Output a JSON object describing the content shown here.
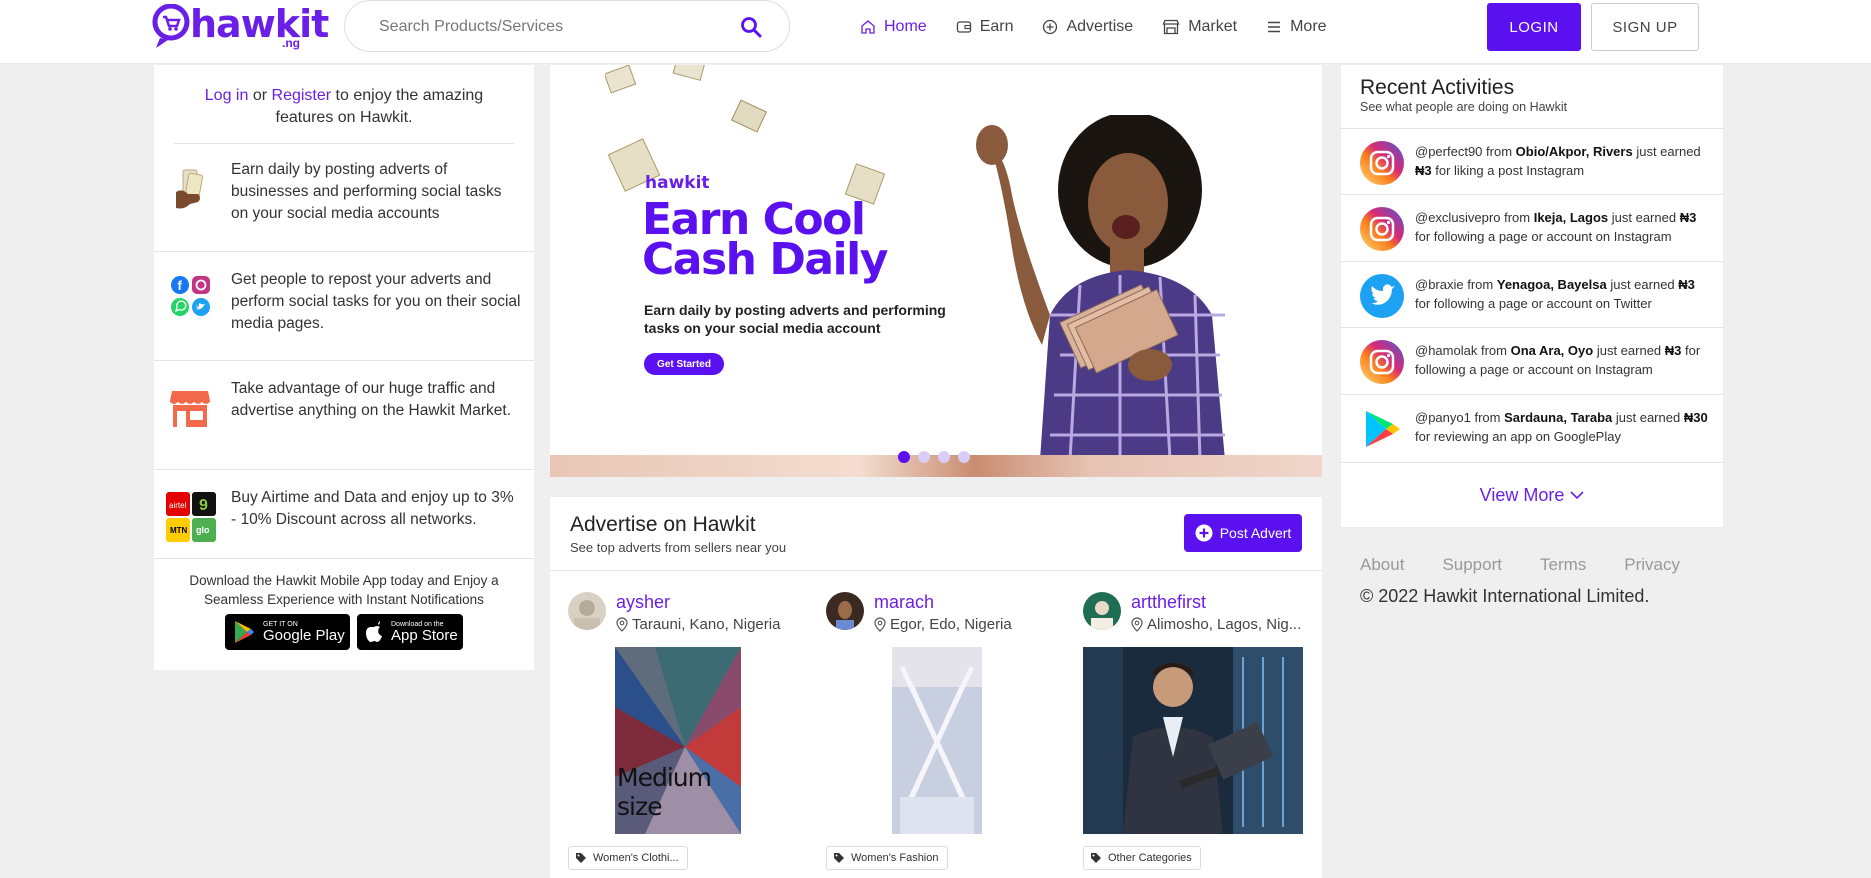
{
  "header": {
    "logo_text": "hawkit",
    "logo_suffix": ".ng",
    "search_placeholder": "Search Products/Services",
    "nav": [
      {
        "label": "Home",
        "icon": "home-icon",
        "active": true
      },
      {
        "label": "Earn",
        "icon": "wallet-icon"
      },
      {
        "label": "Advertise",
        "icon": "plus-circle-icon"
      },
      {
        "label": "Market",
        "icon": "store-icon"
      },
      {
        "label": "More",
        "icon": "menu-icon"
      }
    ],
    "login_label": "LOGIN",
    "signup_label": "SIGN UP"
  },
  "left": {
    "intro_login": "Log in",
    "intro_or": "or",
    "intro_register": "Register",
    "intro_rest": "to enjoy the amazing features on Hawkit.",
    "features": [
      {
        "icon": "money-hand-icon",
        "text": "Earn daily by posting adverts of businesses and performing social tasks on your social media accounts"
      },
      {
        "icon": "social-media-icon",
        "text": "Get people to repost your adverts and perform social tasks for you on their social media pages."
      },
      {
        "icon": "shop-icon",
        "text": "Take advantage of our huge traffic and advertise anything on the Hawkit Market."
      },
      {
        "icon": "network-logos-icon",
        "text": "Buy Airtime and Data and enjoy up to 3% - 10% Discount across all networks."
      }
    ],
    "download_text": "Download the Hawkit Mobile App today and Enjoy a Seamless Experience with Instant Notifications",
    "google_play_small": "GET IT ON",
    "google_play_big": "Google Play",
    "app_store_small": "Download on the",
    "app_store_big": "App Store"
  },
  "banner": {
    "logo": "hawkit",
    "title_line1": "Earn Cool",
    "title_line2": "Cash Daily",
    "subtitle": "Earn daily by posting adverts and performing tasks on your social media account",
    "button": "Get Started",
    "slide_count": 4,
    "active_slide": 1
  },
  "advertise": {
    "title": "Advertise on Hawkit",
    "subtitle": "See top adverts from sellers near you",
    "post_button": "Post Advert",
    "cards": [
      {
        "name": "aysher",
        "location": "Tarauni, Kano, Nigeria",
        "image_caption": "Medium size",
        "tag": "Women's Clothi..."
      },
      {
        "name": "marach",
        "location": "Egor, Edo, Nigeria",
        "tag": "Women's Fashion"
      },
      {
        "name": "artthefirst",
        "location": "Alimosho, Lagos, Nig...",
        "tag": "Other Categories"
      }
    ]
  },
  "activities": {
    "title": "Recent Activities",
    "subtitle": "See what people are doing on Hawkit",
    "items": [
      {
        "icon": "instagram-icon",
        "user": "@perfect90",
        "from": "from",
        "place": "Obio/Akpor, Rivers",
        "mid": "just earned",
        "amount": "₦3",
        "task": "for liking a post Instagram"
      },
      {
        "icon": "instagram-icon",
        "user": "@exclusivepro",
        "from": "from",
        "place": "Ikeja, Lagos",
        "mid": "just earned",
        "amount": "₦3",
        "task": "for following a page or account on Instagram"
      },
      {
        "icon": "twitter-icon",
        "user": "@braxie",
        "from": "from",
        "place": "Yenagoa, Bayelsa",
        "mid": "just earned",
        "amount": "₦3",
        "task": "for following a page or account on Twitter"
      },
      {
        "icon": "instagram-icon",
        "user": "@hamolak",
        "from": "from",
        "place": "Ona Ara, Oyo",
        "mid": "just earned",
        "amount": "₦3",
        "task": "for following a page or account on Instagram"
      },
      {
        "icon": "google-play-icon",
        "user": "@panyo1",
        "from": "from",
        "place": "Sardauna, Taraba",
        "mid": "just earned",
        "amount": "₦30",
        "task": "for reviewing an app on GooglePlay"
      }
    ],
    "view_more": "View More"
  },
  "footer": {
    "links": [
      "About",
      "Support",
      "Terms",
      "Privacy"
    ],
    "copyright": "© 2022 Hawkit International Limited."
  }
}
